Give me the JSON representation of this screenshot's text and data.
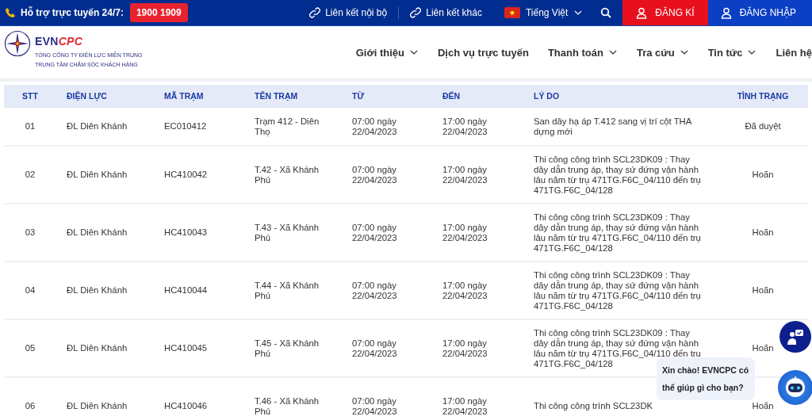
{
  "top_bar": {
    "support_label": "Hỗ trợ trực tuyến 24/7:",
    "hotline": "1900 1909",
    "links": [
      "Liên kết nội bộ",
      "Liên kết khác"
    ],
    "language": "Tiếng Việt",
    "register": "ĐĂNG KÍ",
    "login": "ĐĂNG NHẬP"
  },
  "header": {
    "brand_left": "EVN",
    "brand_right": "CPC",
    "subtitle_lines": [
      "TỔNG CÔNG TY ĐIỆN LỰC MIỀN TRUNG",
      "TRUNG TÂM CHĂM SÓC KHÁCH HÀNG"
    ],
    "nav": [
      {
        "label": "Giới thiệu",
        "has_menu": true
      },
      {
        "label": "Dịch vụ trực tuyến",
        "has_menu": false
      },
      {
        "label": "Thanh toán",
        "has_menu": true
      },
      {
        "label": "Tra cứu",
        "has_menu": true
      },
      {
        "label": "Tin tức",
        "has_menu": true
      },
      {
        "label": "Liên hệ",
        "has_menu": false
      }
    ]
  },
  "table": {
    "columns": [
      "STT",
      "ĐIỆN LỰC",
      "MÃ TRẠM",
      "TÊN TRẠM",
      "TỪ",
      "ĐẾN",
      "LÝ DO",
      "TÌNH TRẠNG"
    ],
    "rows": [
      [
        "01",
        "ĐL Diên Khánh",
        "EC010412",
        "Trạm 412 - Diên Thọ",
        "07:00 ngày 22/04/2023",
        "17:00 ngày 22/04/2023",
        "San dây hạ áp T.412 sang vị trí cột THA dựng mới",
        "Đã duyệt"
      ],
      [
        "02",
        "ĐL Diên Khánh",
        "HC410042",
        "T.42 - Xã Khánh Phú",
        "07:00 ngày 22/04/2023",
        "17:00 ngày 22/04/2023",
        "Thi công công trình SCL23DK09 : Thay dây dẫn trung áp, thay sứ đứng vận hành lâu năm từ trụ 471TG.F6C_04/110 đến trụ 471TG.F6C_04/128",
        "Hoãn"
      ],
      [
        "03",
        "ĐL Diên Khánh",
        "HC410043",
        "T.43 - Xã Khánh Phú",
        "07:00 ngày 22/04/2023",
        "17:00 ngày 22/04/2023",
        "Thi công công trình SCL23DK09 : Thay dây dẫn trung áp, thay sứ đứng vận hành lâu năm từ trụ 471TG.F6C_04/110 đến trụ 471TG.F6C_04/128",
        "Hoãn"
      ],
      [
        "04",
        "ĐL Diên Khánh",
        "HC410044",
        "T.44 - Xã Khánh Phú",
        "07:00 ngày 22/04/2023",
        "17:00 ngày 22/04/2023",
        "Thi công công trình SCL23DK09 : Thay dây dẫn trung áp, thay sứ đứng vận hành lâu năm từ trụ 471TG.F6C_04/110 đến trụ 471TG.F6C_04/128",
        "Hoãn"
      ],
      [
        "05",
        "ĐL Diên Khánh",
        "HC410045",
        "T.45 - Xã Khánh Phú",
        "07:00 ngày 22/04/2023",
        "17:00 ngày 22/04/2023",
        "Thi công công trình SCL23DK09 : Thay dây dẫn trung áp, thay sứ đứng vận hành lâu năm từ trụ 471TG.F6C_04/110 đến trụ 471TG.F6C_04/128",
        "Hoãn"
      ],
      [
        "06",
        "ĐL Diên Khánh",
        "HC410046",
        "T.46 - Xã Khánh Phú",
        "07:00 ngày 22/04/2023",
        "17:00 ngày 22/04/2023",
        "Thi công công trình SCL23DK",
        "Hoãn"
      ]
    ]
  },
  "chat": {
    "greeting": "Xin chào! EVNCPC có thể giúp gì cho bạn?"
  }
}
